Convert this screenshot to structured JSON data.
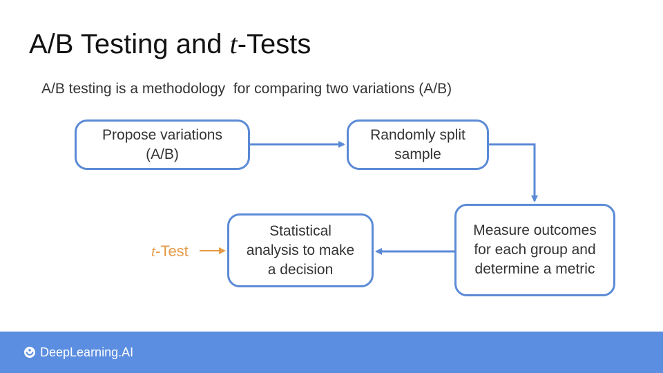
{
  "slide": {
    "title_prefix": "A/B Testing and ",
    "title_italic": "t",
    "title_suffix": "-Tests",
    "subtitle": "A/B testing is a methodology  for comparing two variations (A/B)"
  },
  "diagram": {
    "steps": [
      {
        "id": "propose",
        "label": "Propose variations\n(A/B)"
      },
      {
        "id": "split",
        "label": "Randomly split\nsample"
      },
      {
        "id": "measure",
        "label": "Measure outcomes\nfor each group and\ndetermine a metric"
      },
      {
        "id": "analysis",
        "label": "Statistical\nanalysis to make\na decision"
      }
    ],
    "input_label_italic": "t",
    "input_label_suffix": "-Test"
  },
  "footer": {
    "brand": "DeepLearning.AI"
  },
  "colors": {
    "box_border": "#5b8ad6",
    "arrow": "#5b8ad6",
    "ttest": "#e69a45",
    "footer_bg": "#5b8ee0"
  },
  "icons": {
    "logo": "deeplearning-logo-icon"
  }
}
